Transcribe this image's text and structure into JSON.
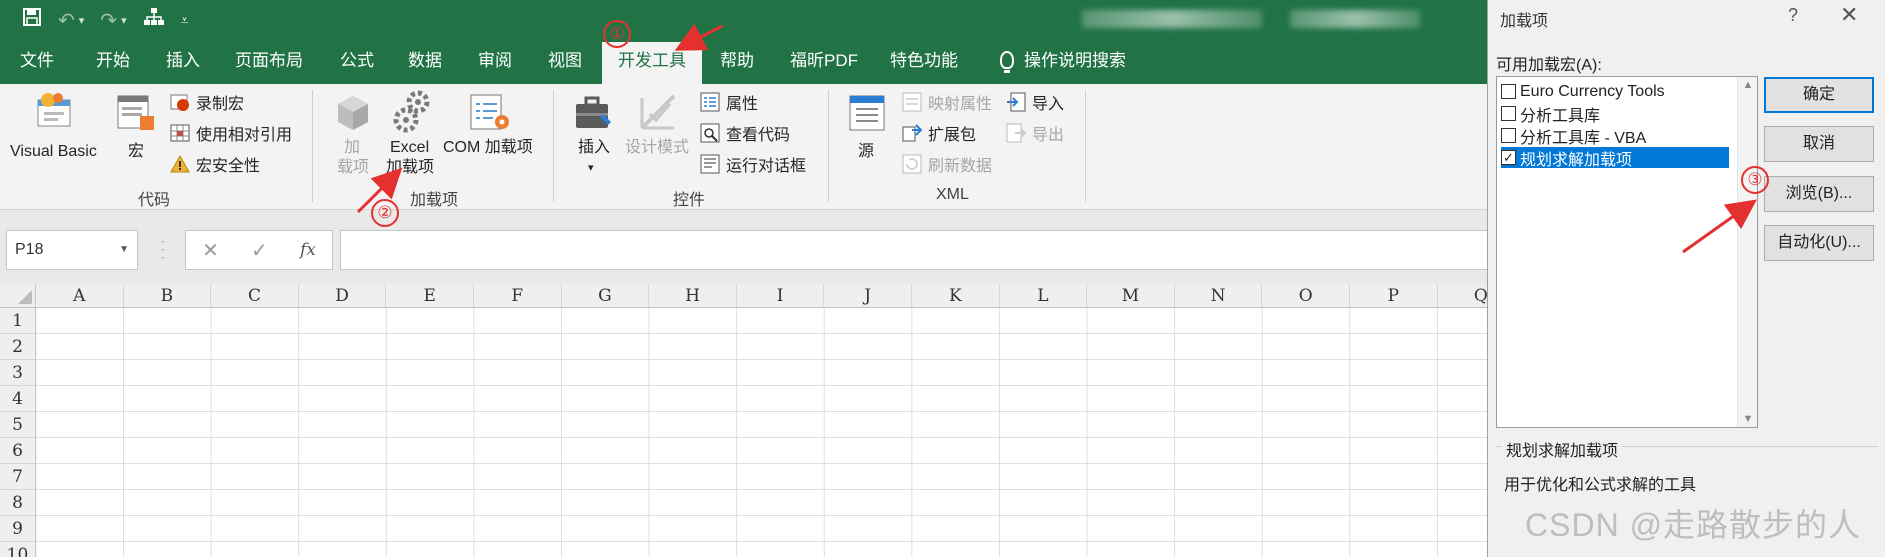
{
  "qat": {
    "save": "save-icon",
    "undo": "undo-icon",
    "redo": "redo-icon",
    "tree": "org-chart-icon",
    "customize": "customize-caret-icon"
  },
  "tabs": [
    {
      "label": "文件"
    },
    {
      "label": "开始"
    },
    {
      "label": "插入"
    },
    {
      "label": "页面布局"
    },
    {
      "label": "公式"
    },
    {
      "label": "数据"
    },
    {
      "label": "审阅"
    },
    {
      "label": "视图"
    },
    {
      "label": "开发工具",
      "active": true
    },
    {
      "label": "帮助"
    },
    {
      "label": "福昕PDF"
    },
    {
      "label": "特色功能"
    },
    {
      "label": "操作说明搜索"
    }
  ],
  "ribbon": {
    "code": {
      "label": "代码",
      "visual_basic": "Visual Basic",
      "macros": "宏",
      "record_macro": "录制宏",
      "relative_ref": "使用相对引用",
      "macro_security": "宏安全性"
    },
    "addins": {
      "label": "加载项",
      "addins_line1": "加",
      "addins_line2": "载项",
      "excel_line1": "Excel",
      "excel_line2": "加载项",
      "com": "COM 加载项"
    },
    "controls": {
      "label": "控件",
      "insert": "插入",
      "design_mode": "设计模式",
      "properties": "属性",
      "view_code": "查看代码",
      "run_dialog": "运行对话框"
    },
    "xml": {
      "label": "XML",
      "source": "源",
      "map_properties": "映射属性",
      "expansion_packs": "扩展包",
      "refresh_data": "刷新数据",
      "import": "导入",
      "export": "导出"
    }
  },
  "formula_bar": {
    "name_box": "P18",
    "cancel": "✕",
    "enter": "✓",
    "fx": "fx",
    "value": ""
  },
  "grid": {
    "columns": [
      "A",
      "B",
      "C",
      "D",
      "E",
      "F",
      "G",
      "H",
      "I",
      "J",
      "K",
      "L",
      "M",
      "N",
      "O",
      "P",
      "Q"
    ],
    "rows": [
      "1",
      "2",
      "3",
      "4",
      "5",
      "6",
      "7",
      "8",
      "9",
      "10"
    ]
  },
  "dialog": {
    "title": "加载项",
    "help": "?",
    "close": "✕",
    "available_label": "可用加载宏(A):",
    "items": [
      {
        "label": "Euro Currency Tools",
        "checked": false,
        "selected": false
      },
      {
        "label": "分析工具库",
        "checked": false,
        "selected": false
      },
      {
        "label": "分析工具库 - VBA",
        "checked": false,
        "selected": false
      },
      {
        "label": "规划求解加载项",
        "checked": true,
        "selected": true
      }
    ],
    "buttons": {
      "ok": "确定",
      "cancel": "取消",
      "browse": "浏览(B)...",
      "automation": "自动化(U)..."
    },
    "description_title": "规划求解加载项",
    "description_text": "用于优化和公式求解的工具"
  },
  "annotations": {
    "step1": "①",
    "step2": "②",
    "step3": "③",
    "color": "#e53030"
  },
  "watermark": "CSDN @走路散步的人",
  "colors": {
    "excel_green": "#217346",
    "ribbon_bg": "#f3f3f3",
    "selection_blue": "#0078d7"
  }
}
